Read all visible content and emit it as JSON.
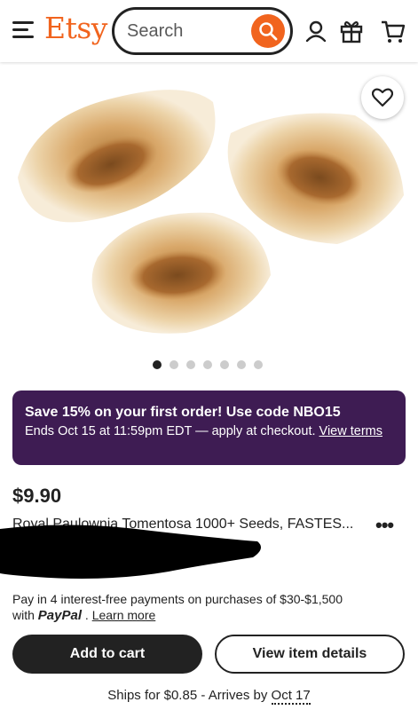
{
  "header": {
    "logo": "Etsy",
    "search_placeholder": "Search",
    "icons": [
      "menu-icon",
      "search-icon",
      "account-icon",
      "gift-icon",
      "cart-icon"
    ]
  },
  "gallery": {
    "image_count": 7,
    "active_index": 0,
    "favorite_icon": "heart-icon"
  },
  "promo": {
    "title": "Save 15% on your first order! Use code NBO15",
    "body": "Ends Oct 15 at 11:59pm EDT — apply at checkout.",
    "link": "View terms"
  },
  "product": {
    "price": "$9.90",
    "title": "Royal Paulownia Tomentosa 1000+ Seeds, FASTES...",
    "more_label": "•••"
  },
  "payment": {
    "line1": "Pay in 4 interest-free payments on purchases of $30-$1,500",
    "with": "with",
    "paypal": "PayPal",
    "sep": ".",
    "learn_more": "Learn more"
  },
  "actions": {
    "add_to_cart": "Add to cart",
    "view_details": "View item details"
  },
  "shipping": {
    "ships_for": "Ships for $0.85",
    "sep": "-",
    "arrives_prefix": "Arrives by",
    "arrives_date": "Oct 17"
  },
  "colors": {
    "brand": "#f1641e",
    "promo_bg": "#3e1c53",
    "text": "#222222"
  }
}
